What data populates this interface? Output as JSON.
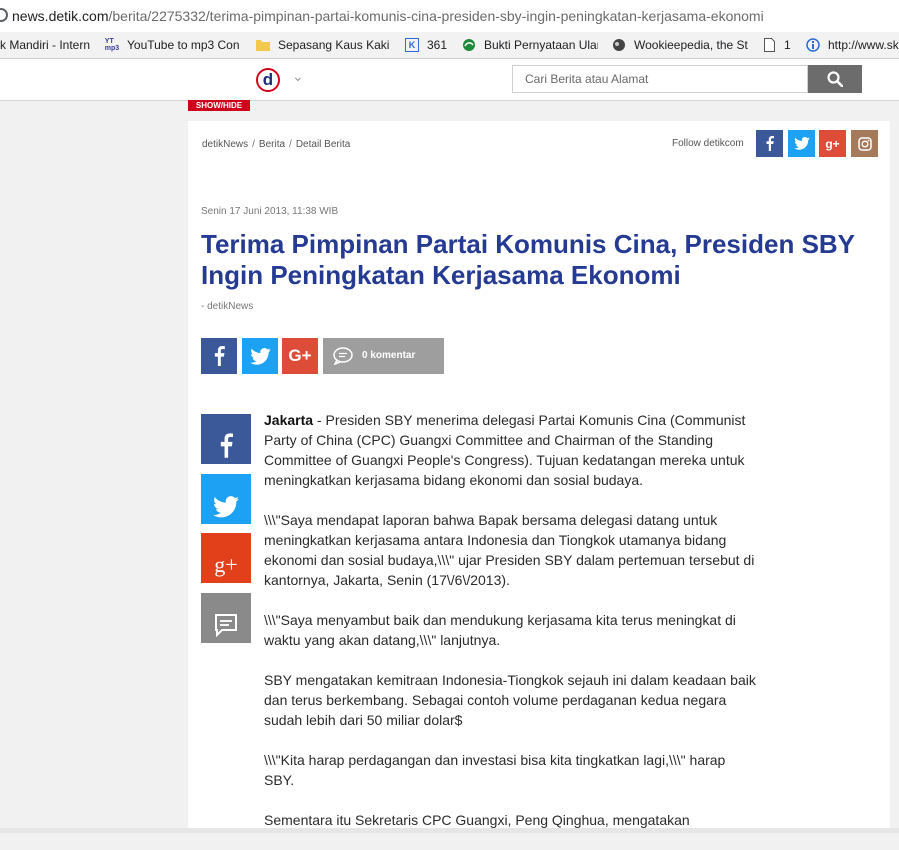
{
  "browser": {
    "url_host": "news.detik.com",
    "url_path": "/berita/2275332/terima-pimpinan-partai-komunis-cina-presiden-sby-ingin-peningkatan-kerjasama-ekonomi",
    "bookmarks": [
      {
        "label": "k Mandiri - Intern",
        "icon": "bank-icon"
      },
      {
        "label": "YouTube to mp3 Con",
        "icon": "yt-mp3-icon"
      },
      {
        "label": "Sepasang Kaus Kaki H",
        "icon": "folder-icon"
      },
      {
        "label": "361",
        "icon": "k-icon"
      },
      {
        "label": "Bukti Pernyataan Ular",
        "icon": "leaf-icon"
      },
      {
        "label": "Wookieepedia, the St",
        "icon": "globe-icon"
      },
      {
        "label": "1",
        "icon": "page-icon"
      },
      {
        "label": "http://www.sk",
        "icon": "info-icon"
      }
    ]
  },
  "header": {
    "logo_letter": "d",
    "search_placeholder": "Cari Berita atau Alamat"
  },
  "showhide_label": "SHOW/HIDE",
  "breadcrumb": [
    "detikNews",
    "Berita",
    "Detail Berita"
  ],
  "follow_label": "Follow detikcom",
  "article": {
    "date": "Senin 17 Juni 2013, 11:38 WIB",
    "title": "Terima Pimpinan Partai Komunis Cina, Presiden SBY Ingin Peningkatan Kerjasama Ekonomi",
    "source": "- detikNews",
    "comment_label": "0 komentar",
    "dateline": "Jakarta",
    "paragraphs": [
      " - Presiden SBY menerima delegasi Partai Komunis Cina (Communist Party of China (CPC) Guangxi Committee and Chairman of the Standing Committee of Guangxi People's Congress). Tujuan kedatangan mereka untuk meningkatkan kerjasama bidang ekonomi dan sosial budaya.",
      "\\\\\\\"Saya mendapat laporan bahwa Bapak bersama delegasi datang untuk meningkatkan kerjasama antara Indonesia dan Tiongkok utamanya bidang ekonomi dan sosial budaya,\\\\\\\" ujar Presiden SBY dalam pertemuan tersebut di kantornya, Jakarta, Senin (17\\/6\\/2013).",
      "\\\\\\\"Saya menyambut baik dan mendukung kerjasama kita terus meningkat di waktu yang akan datang,\\\\\\\" lanjutnya.",
      "SBY mengatakan kemitraan Indonesia-Tiongkok sejauh ini dalam keadaan baik dan terus berkembang. Sebagai contoh volume perdaganan kedua negara sudah lebih dari 50 miliar dolar$",
      "\\\\\\\"Kita harap perdagangan dan investasi bisa kita tingkatkan lagi,\\\\\\\" harap SBY.",
      "Sementara itu Sekretaris CPC Guangxi, Peng Qinghua, mengatakan"
    ]
  },
  "colors": {
    "facebook": "#3b5998",
    "twitter": "#1da1f2",
    "google_plus": "#dd4b39",
    "instagram": "#a57a5a",
    "title": "#253a92",
    "brand_red": "#d0021b"
  }
}
